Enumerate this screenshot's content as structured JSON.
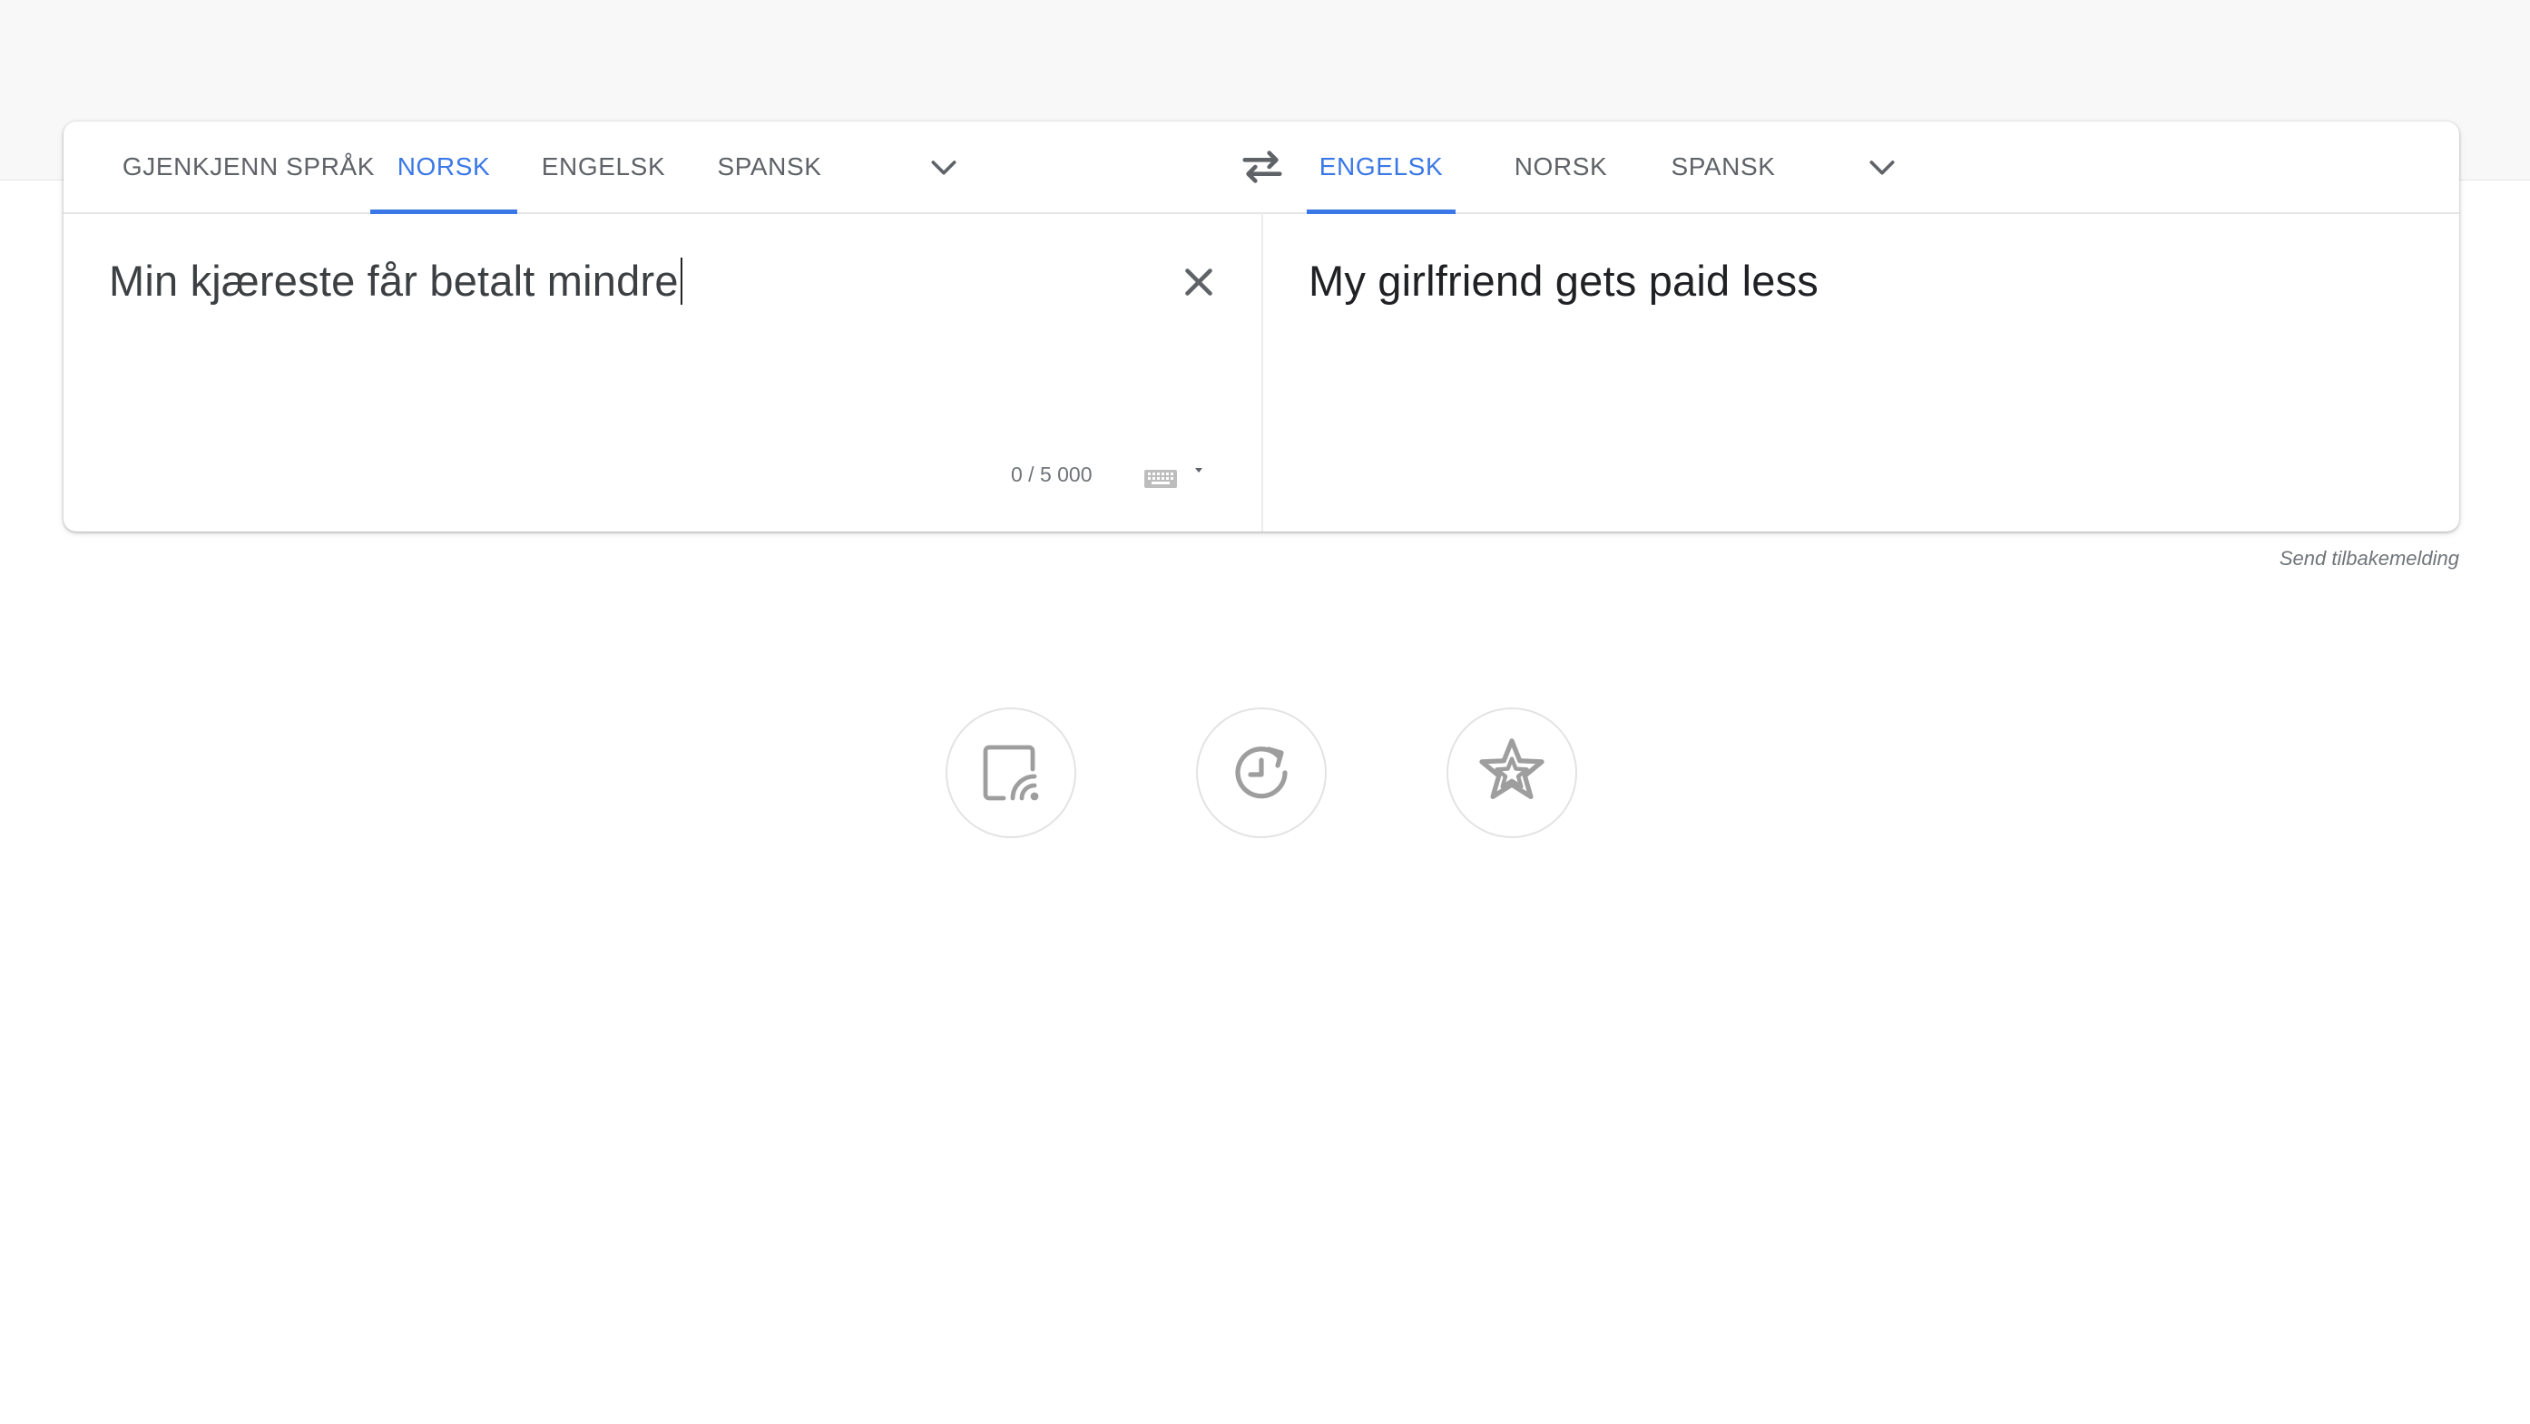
{
  "source_languages": {
    "tabs": [
      {
        "label": "GJENKJENN SPRÅK",
        "active": false
      },
      {
        "label": "NORSK",
        "active": true
      },
      {
        "label": "ENGELSK",
        "active": false
      },
      {
        "label": "SPANSK",
        "active": false
      }
    ]
  },
  "target_languages": {
    "tabs": [
      {
        "label": "ENGELSK",
        "active": true
      },
      {
        "label": "NORSK",
        "active": false
      },
      {
        "label": "SPANSK",
        "active": false
      }
    ]
  },
  "source": {
    "text": "Min kjæreste får betalt mindre",
    "char_count": "0 / 5 000"
  },
  "target": {
    "text": "My girlfriend gets paid less"
  },
  "feedback_link": "Send tilbakemelding",
  "actions": [
    {
      "icon": "saved-cast-icon"
    },
    {
      "icon": "history-icon"
    },
    {
      "icon": "saved-stars-icon"
    }
  ],
  "colors": {
    "accent": "#3b78e7",
    "text": "#5f6368",
    "icon": "#9e9e9e"
  }
}
